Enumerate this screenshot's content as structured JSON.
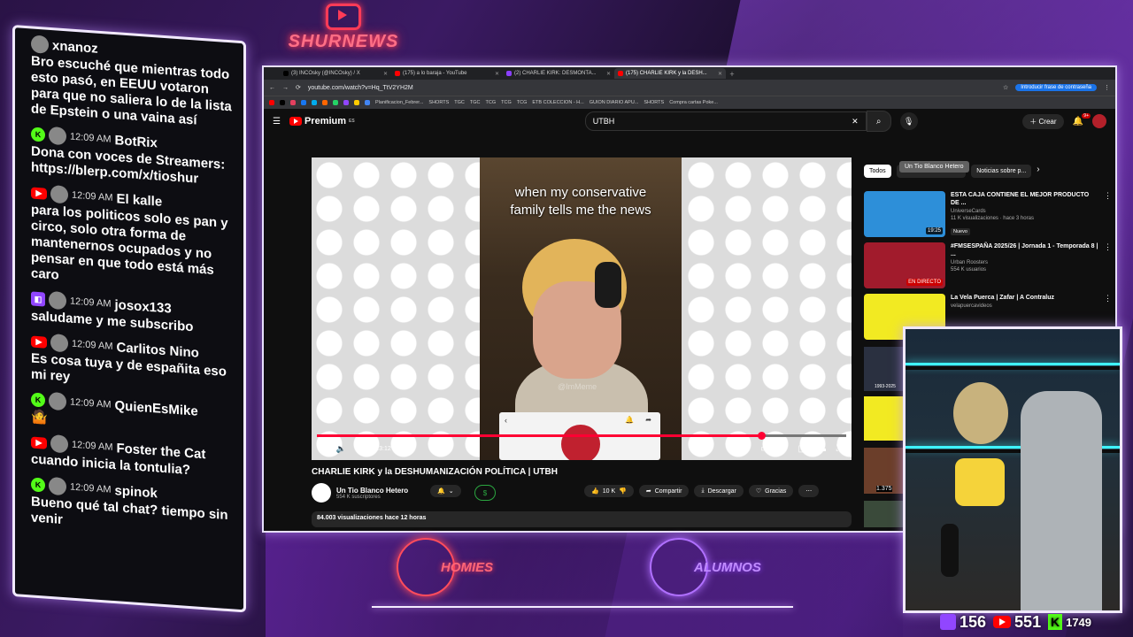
{
  "overlay": {
    "logo_text": "SHURNEWS",
    "brand_left": "HOMIES",
    "brand_right": "ALUMNOS",
    "colors": {
      "accent_red": "#ff3b57",
      "accent_purple": "#9146ff",
      "kick_green": "#53fc18",
      "youtube_red": "#ff0000"
    }
  },
  "chat": {
    "messages": [
      {
        "platform": "",
        "time": "",
        "user": "xnanoz",
        "text": "Bro escuché que mientras todo esto pasó, en EEUU votaron para que no saliera lo de la lista de Epstein o una vaina así"
      },
      {
        "platform": "kick",
        "time": "12:09 AM",
        "user": "BotRix",
        "text": "Dona con voces de Streamers: https://blerp.com/x/tioshur"
      },
      {
        "platform": "youtube",
        "time": "12:09 AM",
        "user": "El kalle",
        "text": "para los politicos solo es pan y circo, solo otra forma de mantenernos ocupados y no pensar en que todo está más caro"
      },
      {
        "platform": "twitch",
        "time": "12:09 AM",
        "user": "josox133",
        "text": "saludame y me subscribo"
      },
      {
        "platform": "youtube",
        "time": "12:09 AM",
        "user": "Carlitos Nino",
        "text": "Es cosa tuya y de españita eso mi rey"
      },
      {
        "platform": "kick",
        "time": "12:09 AM",
        "user": "QuienEsMike",
        "text": "🤷"
      },
      {
        "platform": "youtube",
        "time": "12:09 AM",
        "user": "Foster the Cat",
        "text": "cuando inicia la tontulia?"
      },
      {
        "platform": "kick",
        "time": "12:09 AM",
        "user": "spinok",
        "text": "Bueno qué tal chat? tiempo sin venir"
      }
    ]
  },
  "browser": {
    "tabs": [
      {
        "label": "(3) INCOsky (@INCOsky) / X",
        "active": false
      },
      {
        "label": "(175) a lo baraja - YouTube",
        "active": false
      },
      {
        "label": "(2) CHARLIE KIRK: DESMONTA...",
        "active": false
      },
      {
        "label": "(175) CHARLIE KIRK y la DESH...",
        "active": true
      }
    ],
    "url": "youtube.com/watch?v=Hq_TtV2YH2M",
    "password_chip": "Introducir frase de contraseña",
    "bookmarks": [
      "Planificacion_Febrer...",
      "SHORTS",
      "TGC",
      "TGC",
      "TCG",
      "TCG",
      "TCG",
      "ETB COLECCION - H...",
      "GUION DIARIO APU...",
      "SHORTS",
      "Compra cartas Poke..."
    ]
  },
  "youtube": {
    "logo": "Premium",
    "logo_region": "ES",
    "search_value": "UTBH",
    "create_label": "Crear",
    "notif_count": "9+",
    "video": {
      "caption_line1": "when my conservative",
      "caption_line2": "family tells me the news",
      "watermark": "@ImMeme",
      "time": "19:34 / 23:12",
      "progress": 0.84
    },
    "title": "CHARLIE KIRK y la DESHUMANIZACIÓN POLÍTICA | UTBH",
    "channel_name": "Un Tio Blanco Hetero",
    "subscribers": "554 K suscriptores",
    "likes": "10 K",
    "share_label": "Compartir",
    "download_label": "Descargar",
    "thanks_label": "Gracias",
    "money_symbol": "$",
    "desc_line": "84.003 visualizaciones  hace 12 horas",
    "chips": [
      "Todos",
      "Un Tio Blanco Hetero",
      "Noticias sobre p..."
    ],
    "tooltip": "Un Tio Blanco Hetero",
    "recommendations": [
      {
        "title": "ESTA CAJA CONTIENE EL MEJOR PRODUCTO DE ...",
        "channel": "UniverseCards",
        "meta": "11 K visualizaciones · hace 3 horas",
        "tag": "Nuevo",
        "duration": "19:25",
        "color": "#2d8fd9"
      },
      {
        "title": "#FMSESPAÑA 2025/26 | Jornada 1 - Temporada 8 | ...",
        "channel": "Urban Roosters",
        "meta": "554 K usuarios",
        "tag": "",
        "duration": "EN DIRECTO",
        "color": "#a11b2c"
      },
      {
        "title": "La Vela Puerca | Zafar | A Contraluz",
        "channel": "velapuercavideos",
        "meta": "",
        "tag": "",
        "duration": "",
        "color": "#f2ea22"
      }
    ],
    "side_thumb_labels": [
      "1993-2025",
      "1.375"
    ]
  },
  "stats": {
    "twitch": "156",
    "youtube": "551",
    "kick": "1749"
  }
}
